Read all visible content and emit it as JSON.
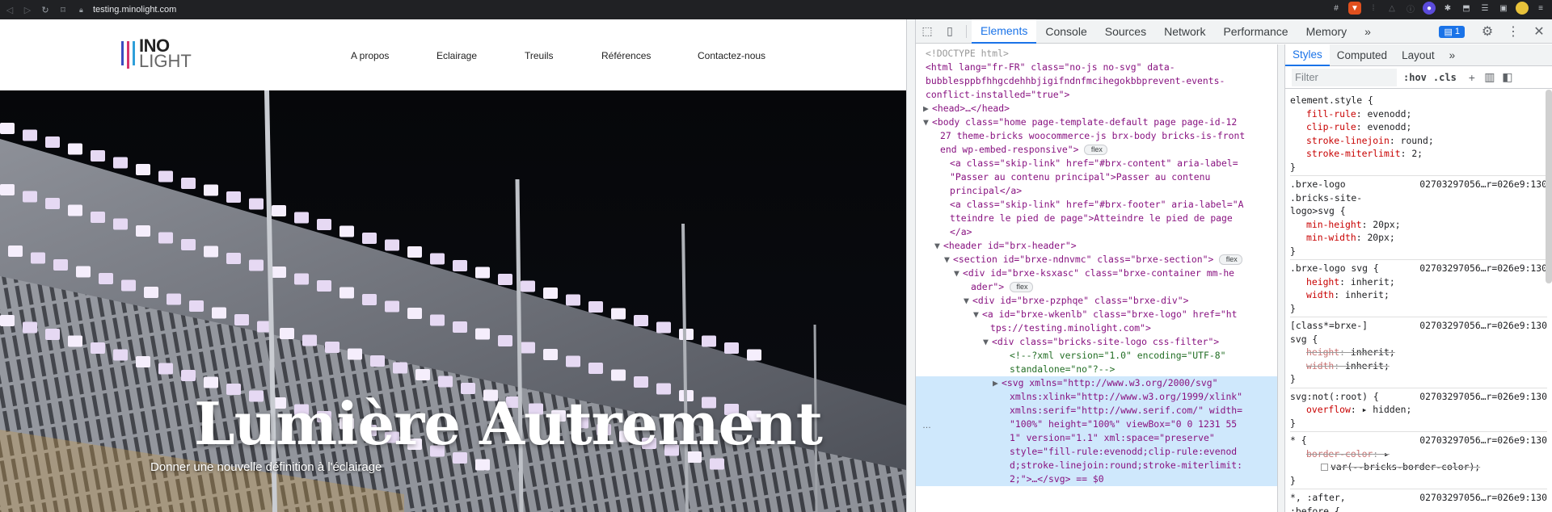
{
  "browser": {
    "url": "testing.minolight.com"
  },
  "site": {
    "logo": {
      "line1": "INO",
      "line2": "LIGHT"
    },
    "nav": [
      "A propos",
      "Eclairage",
      "Treuils",
      "Références",
      "Contactez-nous"
    ],
    "hero": {
      "title": "Lumière Autrement",
      "subtitle": "Donner une nouvelle définition à l'éclairage"
    }
  },
  "devtools": {
    "tabs": [
      "Elements",
      "Console",
      "Sources",
      "Network",
      "Performance",
      "Memory"
    ],
    "issues_count": "1",
    "styles_tabs": [
      "Styles",
      "Computed",
      "Layout"
    ],
    "filter_placeholder": "Filter",
    "hov": ":hov",
    "cls": ".cls",
    "dom": [
      "<!DOCTYPE html>",
      "<html lang=\"fr-FR\" class=\"no-js no-svg\" data-",
      "bubblesppbfhhgcdehhbjigifndnfmcihegokbbprevent-events-",
      "conflict-installed=\"true\">",
      "<head>…</head>",
      "<body class=\"home page-template-default page page-id-12",
      "27 theme-bricks woocommerce-js brx-body bricks-is-front",
      "end wp-embed-responsive\">",
      "<a class=\"skip-link\" href=\"#brx-content\" aria-label=",
      "\"Passer au contenu principal\">Passer au contenu",
      "principal</a>",
      "<a class=\"skip-link\" href=\"#brx-footer\" aria-label=\"A",
      "tteindre le pied de page\">Atteindre le pied de page",
      "</a>",
      "<header id=\"brx-header\">",
      "<section id=\"brxe-ndnvmc\" class=\"brxe-section\">",
      "<div id=\"brxe-ksxasc\" class=\"brxe-container mm-he",
      "ader\">",
      "<div id=\"brxe-pzphqe\" class=\"brxe-div\">",
      "<a id=\"brxe-wkenlb\" class=\"brxe-logo\" href=\"ht",
      "tps://testing.minolight.com\">",
      "<div class=\"bricks-site-logo css-filter\">",
      "<!--?xml version=\"1.0\" encoding=\"UTF-8\"",
      "standalone=\"no\"?-->",
      "<svg xmlns=\"http://www.w3.org/2000/svg\"",
      "xmlns:xlink=\"http://www.w3.org/1999/xlink\"",
      "xmlns:serif=\"http://www.serif.com/\" width=",
      "\"100%\" height=\"100%\" viewBox=\"0 0 1231 55",
      "1\" version=\"1.1\" xml:space=\"preserve\"",
      "style=\"fill-rule:evenodd;clip-rule:evenod",
      "d;stroke-linejoin:round;stroke-miterlimit:",
      "2;\">…</svg> == $0"
    ],
    "flex": "flex",
    "rules": [
      {
        "selector": "element.style {",
        "source": "",
        "decls": [
          [
            "fill-rule",
            "evenodd;"
          ],
          [
            "clip-rule",
            "evenodd;"
          ],
          [
            "stroke-linejoin",
            "round;"
          ],
          [
            "stroke-miterlimit",
            "2;"
          ]
        ]
      },
      {
        "selector": ".brxe-logo\n.bricks-site-\nlogo>svg {",
        "source": "02703297056…r=026e9:130",
        "decls": [
          [
            "min-height",
            "20px;"
          ],
          [
            "min-width",
            "20px;"
          ]
        ]
      },
      {
        "selector": ".brxe-logo svg {",
        "source": "02703297056…r=026e9:130",
        "decls": [
          [
            "height",
            "inherit;"
          ],
          [
            "width",
            "inherit;"
          ]
        ]
      },
      {
        "selector": "[class*=brxe-]\nsvg {",
        "source": "02703297056…r=026e9:130",
        "decls": [
          [
            "height",
            "inherit;"
          ],
          [
            "width",
            "inherit;"
          ]
        ],
        "struck": true
      },
      {
        "selector": "svg:not(:root) {",
        "source": "02703297056…r=026e9:130",
        "decls": [
          [
            "overflow",
            "▸ hidden;"
          ]
        ]
      },
      {
        "selector": "* {",
        "source": "02703297056…r=026e9:130",
        "decls": [
          [
            "border-color",
            "▸"
          ],
          [
            "",
            "var(--bricks-border-color);"
          ]
        ],
        "struck": true
      },
      {
        "selector": "*, :after,\n:before {",
        "source": "02703297056…r=026e9:130",
        "decls": []
      }
    ],
    "close": "}"
  },
  "colors": {
    "accent": "#1a73e8",
    "logo_bars": [
      "#3b4cc0",
      "#d6336c",
      "#2e9fd9"
    ]
  }
}
